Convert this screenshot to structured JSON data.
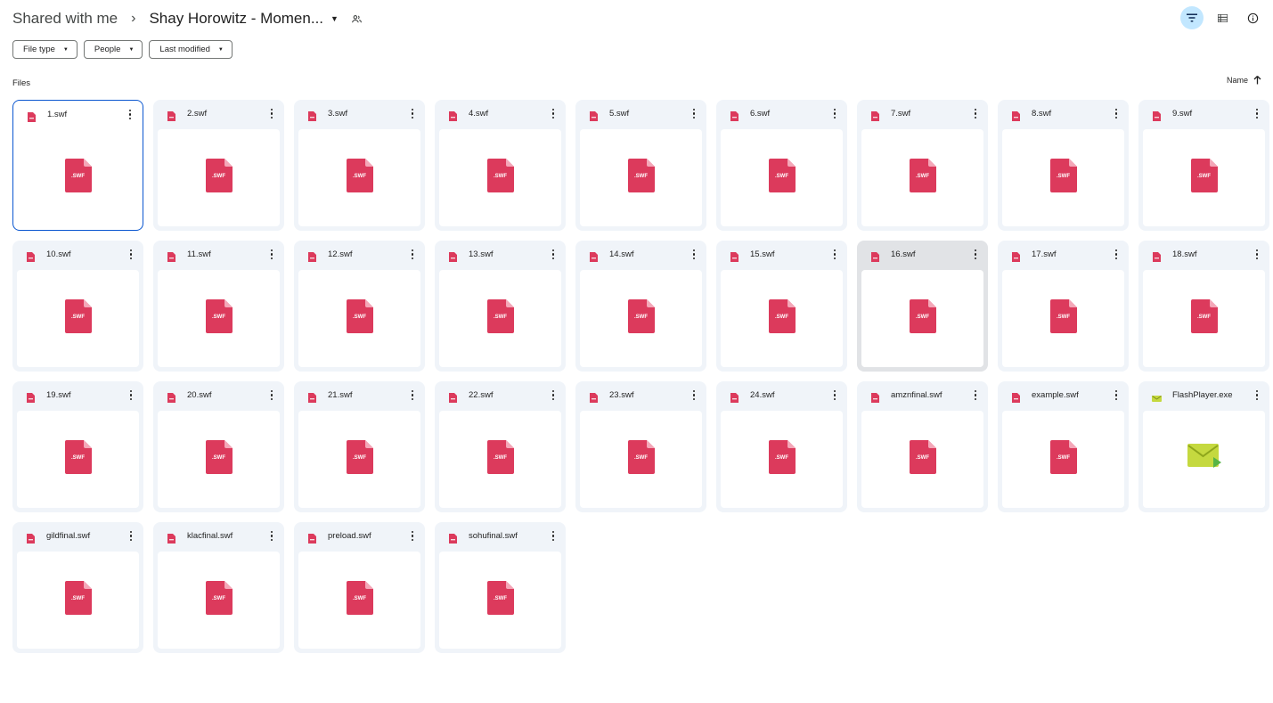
{
  "breadcrumb": {
    "root": "Shared with me",
    "separator": "›",
    "current": "Shay Horowitz - Momen..."
  },
  "top_actions": [
    {
      "name": "filter-icon",
      "active": true
    },
    {
      "name": "details-view-icon",
      "active": false
    },
    {
      "name": "info-icon",
      "active": false
    }
  ],
  "filters": [
    {
      "label": "File type"
    },
    {
      "label": "People"
    },
    {
      "label": "Last modified"
    }
  ],
  "section_title": "Files",
  "sort": {
    "label": "Name",
    "direction_icon": "arrow-up-icon"
  },
  "colors": {
    "swf": "#dc3a5c",
    "swf_fold": "#f4a7b8",
    "exe": "#c5d93f",
    "exe_arrow": "#57b446",
    "selected_border": "#0b57d0",
    "active_btn": "#c2e7ff"
  },
  "files": [
    {
      "name": "1.swf",
      "type": "swf",
      "state": "selected"
    },
    {
      "name": "2.swf",
      "type": "swf"
    },
    {
      "name": "3.swf",
      "type": "swf"
    },
    {
      "name": "4.swf",
      "type": "swf"
    },
    {
      "name": "5.swf",
      "type": "swf"
    },
    {
      "name": "6.swf",
      "type": "swf"
    },
    {
      "name": "7.swf",
      "type": "swf"
    },
    {
      "name": "8.swf",
      "type": "swf"
    },
    {
      "name": "9.swf",
      "type": "swf"
    },
    {
      "name": "10.swf",
      "type": "swf"
    },
    {
      "name": "11.swf",
      "type": "swf"
    },
    {
      "name": "12.swf",
      "type": "swf"
    },
    {
      "name": "13.swf",
      "type": "swf"
    },
    {
      "name": "14.swf",
      "type": "swf"
    },
    {
      "name": "15.swf",
      "type": "swf"
    },
    {
      "name": "16.swf",
      "type": "swf",
      "state": "hovered"
    },
    {
      "name": "17.swf",
      "type": "swf"
    },
    {
      "name": "18.swf",
      "type": "swf"
    },
    {
      "name": "19.swf",
      "type": "swf"
    },
    {
      "name": "20.swf",
      "type": "swf"
    },
    {
      "name": "21.swf",
      "type": "swf"
    },
    {
      "name": "22.swf",
      "type": "swf"
    },
    {
      "name": "23.swf",
      "type": "swf"
    },
    {
      "name": "24.swf",
      "type": "swf"
    },
    {
      "name": "amznfinal.swf",
      "type": "swf"
    },
    {
      "name": "example.swf",
      "type": "swf"
    },
    {
      "name": "FlashPlayer.exe",
      "type": "exe"
    },
    {
      "name": "gildfinal.swf",
      "type": "swf"
    },
    {
      "name": "klacfinal.swf",
      "type": "swf"
    },
    {
      "name": "preload.swf",
      "type": "swf"
    },
    {
      "name": "sohufinal.swf",
      "type": "swf"
    }
  ],
  "swf_badge": ".SWF"
}
